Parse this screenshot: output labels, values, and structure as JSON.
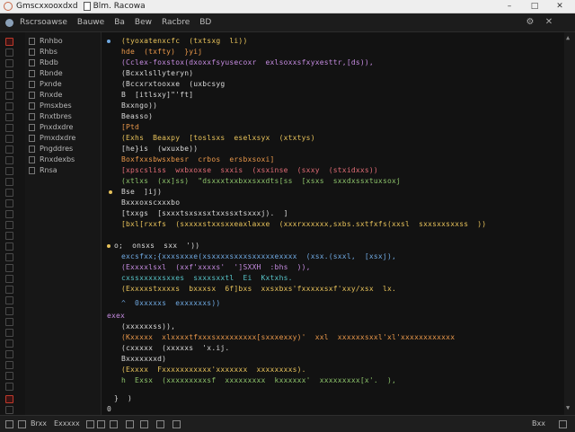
{
  "titlebar": {
    "tab1": "Gmscxxooxdxd",
    "tab2": "Blm. Racowa",
    "minimize": "–",
    "maximize": "□",
    "close": "✕"
  },
  "menubar": {
    "items": [
      "Rscrsoawse",
      "Bauwe",
      "Ba",
      "Bew",
      "Racbre",
      "BD"
    ]
  },
  "sidebar": {
    "items": [
      "Rnhbo",
      "Rhbs",
      "Rbdb",
      "Rbnde",
      "Pxnde",
      "Rnxde",
      "Pmsxbes",
      "Rnxtbres",
      "Pnxdxdre",
      "Pmxdxdre",
      "Pngddres",
      "Rnxdexbs",
      "Rnsa"
    ]
  },
  "editor": {
    "lines": [
      {
        "t": "(tyoxatenxcfc  (txtsxg  li))",
        "c": "c-y"
      },
      {
        "t": "hde  (txfty)  }yij",
        "c": "c-o"
      },
      {
        "t": "(Cclex-foxstox(dxoxxfsyusecoxr  exlsoxxsfxyxesttr,[ds)),",
        "c": "c-p"
      },
      {
        "t": "(Bcxxlsllyteryn)",
        "c": "c-w"
      },
      {
        "t": "(Bccxrxtooxxe  (uxbcsyg",
        "c": "c-w"
      },
      {
        "t": "B  [itlsxy]\"'ft]",
        "c": "c-w"
      },
      {
        "t": "Bxxngo))",
        "c": "c-w"
      },
      {
        "t": "Beasso)",
        "c": "c-w"
      },
      {
        "t": "[Ptd",
        "c": "c-o"
      },
      {
        "t": "(Exhs  Beaxpy  [toslsxs  eselxsyx  (xtxtys)",
        "c": "c-y"
      },
      {
        "t": "[he}is  (wxuxbe))",
        "c": "c-w"
      },
      {
        "t": "Boxfxxsbwsxbesr  crbos  ersbxsoxi]",
        "c": "c-o"
      },
      {
        "t": "[xpscsliss  wxbxoxse  sxxis  (xsxinse  (sxxy  (stxidxxs))",
        "c": "c-r"
      },
      {
        "t": "(xtlxs  (xx]ss)  \"dsxxxtxxbxxsxxdts[ss  [xsxs  sxxdxssxtuxsoxj",
        "c": "c-g"
      },
      {
        "t": "Bse  ]ij)",
        "c": "c-w"
      },
      {
        "t": "Bxxxoxscxxxbo",
        "c": "c-w"
      },
      {
        "t": "[txxgs  [sxxxtsxsxsxtxxssxtsxxxj).  ]",
        "c": "c-w"
      },
      {
        "t": "[bxl[rxxfs  (sxxxxstxxsxxeaxlaxxe  (xxxrxxxxxx,sxbs.sxtfxfs(xxsl  sxxsxxsxxss  ))",
        "c": "c-y"
      },
      {
        "t": "",
        "c": "c-w"
      },
      {
        "t": "o;  onsxs  sxx  '))",
        "c": "c-w"
      },
      {
        "t": "excsfxx;{xxxsxxxe(xsxxxxsxxxsxxxxxexxxx  (xsx.(sxxl,  [xsxj),",
        "c": "c-b"
      },
      {
        "t": "(Exxxxlsxl  (xxf'xxxxs'  ']SXXH  :bhs  )),",
        "c": "c-p"
      },
      {
        "t": "cxssxxxxxsxxes  sxxxsxxtl  Ei  Kxtxhs.",
        "c": "c-c"
      },
      {
        "t": "(Exxxxstxxxxs  bxxxsx  6f]bxs  xxsxbxs'fxxxxxsxf'xxy/xsx  lx.",
        "c": "c-y"
      },
      {
        "t": "^  0xxxxxs  exxxxxxs))",
        "c": "c-b"
      },
      {
        "t": "exex",
        "c": "c-p"
      },
      {
        "t": "(xxxxxxss)),",
        "c": "c-w"
      },
      {
        "t": "(Kxxxxx  xlxxxxtfxxxsxxxxxxxxx[sxxxexxy)'  xxl  xxxxxxsxxl'xl'xxxxxxxxxxxx",
        "c": "c-o"
      },
      {
        "t": "(cxxxxx  (xxxxxs  'x.ij.",
        "c": "c-w"
      },
      {
        "t": "Bxxxxxxxd)",
        "c": "c-w"
      },
      {
        "t": "(Exxxx  Fxxxxxxxxxxx'xxxxxxx  xxxxxxxxs).",
        "c": "c-y"
      },
      {
        "t": "h  Exsx  (xxxxxxxxxsf  xxxxxxxxx  kxxxxxx'  xxxxxxxxx[x'.  ),",
        "c": "c-g"
      },
      {
        "t": "}  )",
        "c": "c-w"
      },
      {
        "t": "0",
        "c": "c-w"
      }
    ]
  },
  "statusbar": {
    "left1": "Brxx",
    "left2": "Exxxxx",
    "right1": "Bxx",
    "colors": {
      "accent": "#c0392b"
    }
  }
}
